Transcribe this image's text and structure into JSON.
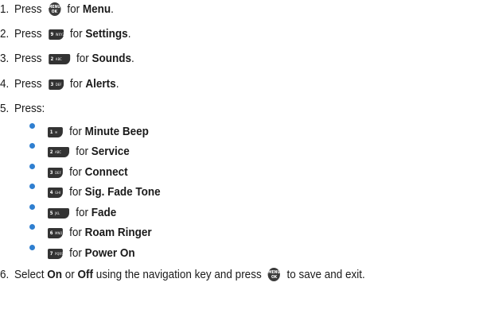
{
  "steps": [
    {
      "num": "1.",
      "pre": "Press ",
      "post": " for ",
      "bold": "Menu",
      "end": ".",
      "key": {
        "line1": "MENU",
        "line2": "OK"
      }
    },
    {
      "num": "2.",
      "pre": "Press ",
      "post": " for ",
      "bold": "Settings",
      "end": ".",
      "key": {
        "digit": "9",
        "letters": "WXYZ"
      }
    },
    {
      "num": "3.",
      "pre": "Press ",
      "post": " for ",
      "bold": "Sounds",
      "end": ".",
      "key": {
        "digit": "2",
        "letters": "ABC"
      }
    },
    {
      "num": "4.",
      "pre": "Press ",
      "post": " for ",
      "bold": "Alerts",
      "end": ".",
      "key": {
        "digit": "3",
        "letters": "DEF"
      }
    },
    {
      "num": "5.",
      "pre": "Press:"
    }
  ],
  "options": [
    {
      "key": {
        "digit": "1",
        "letters": "✉"
      },
      "post": " for ",
      "bold": "Minute Beep"
    },
    {
      "key": {
        "digit": "2",
        "letters": "ABC"
      },
      "post": " for ",
      "bold": "Service"
    },
    {
      "key": {
        "digit": "3",
        "letters": "DEF"
      },
      "post": " for ",
      "bold": "Connect"
    },
    {
      "key": {
        "digit": "4",
        "letters": "GHI"
      },
      "post": " for ",
      "bold": "Sig. Fade Tone"
    },
    {
      "key": {
        "digit": "5",
        "letters": "JKL"
      },
      "post": " for ",
      "bold": "Fade"
    },
    {
      "key": {
        "digit": "6",
        "letters": "MNO"
      },
      "post": " for ",
      "bold": "Roam Ringer"
    },
    {
      "key": {
        "digit": "7",
        "letters": "PQRS"
      },
      "post": " for ",
      "bold": "Power On"
    }
  ],
  "final_step": {
    "num": "6.",
    "t1": "Select ",
    "b1": "On",
    "t2": " or ",
    "b2": "Off",
    "t3": " using the navigation key and press ",
    "t4": " to save and exit.",
    "key": {
      "line1": "MENU",
      "line2": "OK"
    }
  }
}
